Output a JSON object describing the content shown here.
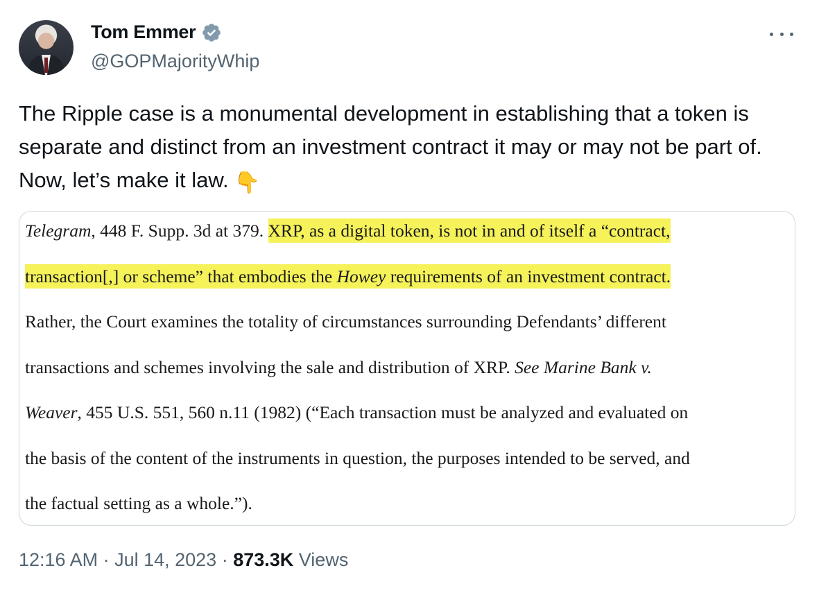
{
  "author": {
    "display_name": "Tom Emmer",
    "handle": "@GOPMajorityWhip",
    "verified_icon": "verified-badge-icon",
    "verified_color": "#829aab"
  },
  "tweet": {
    "text": "The Ripple case is a monumental development in establishing that a token is separate and distinct from an investment contract it may or may not be part of. Now, let’s make it law.",
    "emoji": "👇"
  },
  "quote_image": {
    "highlight_color": "#f5f25a",
    "line1_a": "Telegram",
    "line1_b": ", 448 F. Supp. 3d at 379.  ",
    "line1_hl": "XRP, as a digital token, is not in and of itself a “contract,",
    "line2_hl_a": "transaction[,] or scheme” that embodies the ",
    "line2_hl_b": "Howey",
    "line2_hl_c": " requirements of an investment contract.",
    "line3": "Rather, the Court examines the totality of circumstances surrounding Defendants’ different",
    "line4_a": "transactions and schemes involving the sale and distribution of XRP.  ",
    "line4_b": "See Marine Bank v.",
    "line5_a": "Weaver",
    "line5_b": ", 455 U.S. 551, 560 n.11 (1982) (“Each transaction must be analyzed and evaluated on",
    "line6": "the basis of the content of the instruments in question, the purposes intended to be served, and",
    "line7": "the factual setting as a whole.”)."
  },
  "meta": {
    "time": "12:16 AM",
    "sep1": " · ",
    "date": "Jul 14, 2023",
    "sep2": " · ",
    "views_count": "873.3K",
    "views_label": " Views"
  }
}
